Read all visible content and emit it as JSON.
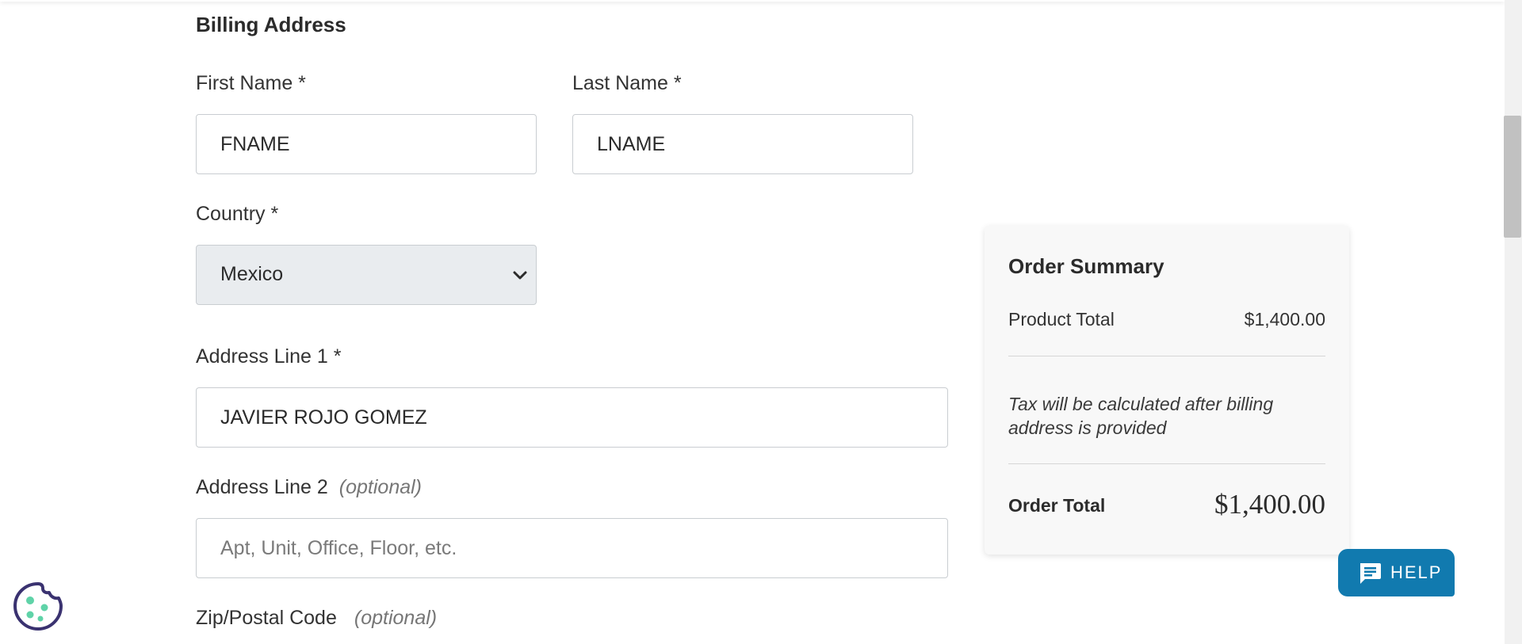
{
  "billing": {
    "section_title": "Billing Address",
    "first_name": {
      "label": "First Name *",
      "value": "FNAME"
    },
    "last_name": {
      "label": "Last Name *",
      "value": "LNAME"
    },
    "country": {
      "label": "Country *",
      "selected": "Mexico"
    },
    "address1": {
      "label": "Address Line 1 *",
      "value": "JAVIER ROJO GOMEZ"
    },
    "address2": {
      "label": "Address Line 2",
      "optional": "(optional)",
      "value": "",
      "placeholder": "Apt, Unit, Office, Floor, etc."
    },
    "zip": {
      "label": "Zip/Postal Code",
      "optional": "(optional)"
    }
  },
  "summary": {
    "title": "Order Summary",
    "product_total_label": "Product Total",
    "product_total_value": "$1,400.00",
    "tax_note": "Tax will be calculated after billing address is provided",
    "order_total_label": "Order Total",
    "order_total_value": "$1,400.00"
  },
  "help": {
    "label": "HELP",
    "icon": "chat-bubble-icon",
    "color": "#117aaf"
  },
  "cookie": {
    "icon": "cookie-icon",
    "color": "#3a3270",
    "accent": "#5fd3a8"
  },
  "colors": {
    "select_bg": "#e9ecef",
    "summary_bg": "#f8f8f8"
  }
}
